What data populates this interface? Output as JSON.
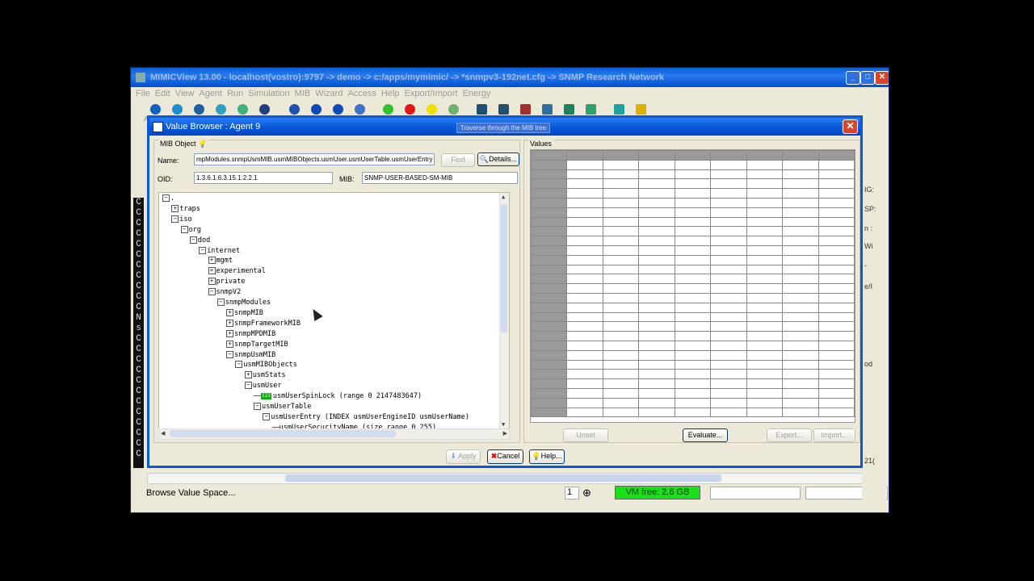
{
  "main_window": {
    "title": "MIMICView 13.00 - localhost(vostro):9797 -> demo -> c:/apps/mymimic/ -> *snmpv3-192net.cfg -> SNMP Research Network",
    "menu": [
      "File",
      "Edit",
      "View",
      "Agent",
      "Run",
      "Simulation",
      "MIB",
      "Wizard",
      "Access",
      "Help",
      "Export/Import",
      "Energy"
    ],
    "toolbar": [
      {
        "label": "Add",
        "icon": "add-icon",
        "color": "#1060c0"
      },
      {
        "label": "Configure",
        "icon": "help-icon",
        "color": "#1a8fd0"
      },
      {
        "label": "Cut",
        "icon": "cut-icon",
        "color": "#2060a0"
      },
      {
        "label": "Copy",
        "icon": "copy-icon",
        "color": "#30a0c0"
      },
      {
        "label": "Paste",
        "icon": "paste-icon",
        "color": "#40b080"
      },
      {
        "label": "Find",
        "icon": "find-icon",
        "color": "#204080"
      },
      {
        "label": "Home",
        "icon": "home-icon",
        "color": "#2050b0"
      },
      {
        "label": "Up",
        "icon": "up-icon",
        "color": "#1048b8"
      },
      {
        "label": "Prev",
        "icon": "prev-icon",
        "color": "#1048b8"
      },
      {
        "label": "Next",
        "icon": "next-icon",
        "color": "#4070c8"
      },
      {
        "label": "Start",
        "icon": "start-icon",
        "color": "#30c030"
      },
      {
        "label": "Stop",
        "icon": "stop-icon",
        "color": "#e01818"
      },
      {
        "label": "Pause",
        "icon": "pause-icon",
        "color": "#f0e000"
      },
      {
        "label": "Resume",
        "icon": "resume-icon",
        "color": "#70b070"
      },
      {
        "label": "Values",
        "icon": "values-icon",
        "color": "#205070"
      },
      {
        "label": "Action",
        "icon": "action-icon",
        "color": "#205070"
      },
      {
        "label": "Trap",
        "icon": "trap-icon",
        "color": "#a03030"
      },
      {
        "label": "Statistics",
        "icon": "statistics-icon",
        "color": "#3070a0"
      },
      {
        "label": "Script",
        "icon": "script-icon",
        "color": "#208060"
      },
      {
        "label": "Record",
        "icon": "record-icon",
        "color": "#30a070"
      },
      {
        "label": "Compile",
        "icon": "compile-icon",
        "color": "#20a0a0"
      },
      {
        "label": "Help",
        "icon": "help-bulb-icon",
        "color": "#e0b000"
      }
    ],
    "status_text": "Browse Value Space...",
    "status_number": "1",
    "vm_free": "VM free: 2.6 GB"
  },
  "left_strip_chars": [
    "C",
    "C",
    "C",
    "C",
    "C",
    "C",
    "C",
    "C",
    "C",
    "C",
    "C",
    "N",
    "s",
    "C",
    "C",
    "C",
    "C",
    "C",
    "C",
    "C",
    "C",
    "C",
    "C",
    "C",
    "C"
  ],
  "right_window_fragments": [
    "IG:",
    "SP:",
    "n :",
    "Wi",
    "-",
    "e/I",
    "od",
    "21("
  ],
  "dialog": {
    "title": "Value Browser : Agent 9",
    "tooltip": "Traverse through the MIB tree",
    "mib_object_label": "MIB Object",
    "name_label": "Name:",
    "name_value": "mpModules.snmpUsmMIB.usmMIBObjects.usmUser.usmUserTable.usmUserEntry",
    "find_label": "Find",
    "details_label": "Details...",
    "oid_label": "OID:",
    "oid_value": "1.3.6.1.6.3.15.1.2.2.1",
    "mib_label": "MIB:",
    "mib_value": "SNMP-USER-BASED-SM-MIB",
    "values_label": "Values",
    "unset_label": "Unset",
    "evaluate_label": "Evaluate...",
    "export_label": "Export...",
    "import_label": "Import...",
    "apply_label": "Apply",
    "cancel_label": "Cancel",
    "help_label": "Help...",
    "tree": [
      {
        "text": ".",
        "level": 0,
        "toggle": "minus"
      },
      {
        "text": "traps",
        "level": 1,
        "toggle": "plus"
      },
      {
        "text": "iso",
        "level": 1,
        "toggle": "minus"
      },
      {
        "text": "org",
        "level": 2,
        "toggle": "minus"
      },
      {
        "text": "dod",
        "level": 3,
        "toggle": "minus"
      },
      {
        "text": "internet",
        "level": 4,
        "toggle": "minus"
      },
      {
        "text": "mgmt",
        "level": 5,
        "toggle": "plus"
      },
      {
        "text": "experimental",
        "level": 5,
        "toggle": "plus"
      },
      {
        "text": "private",
        "level": 5,
        "toggle": "plus"
      },
      {
        "text": "snmpV2",
        "level": 5,
        "toggle": "minus"
      },
      {
        "text": "snmpModules",
        "level": 6,
        "toggle": "minus"
      },
      {
        "text": "snmpMIB",
        "level": 7,
        "toggle": "plus"
      },
      {
        "text": "snmpFrameworkMIB",
        "level": 7,
        "toggle": "plus"
      },
      {
        "text": "snmpMPDMIB",
        "level": 7,
        "toggle": "plus"
      },
      {
        "text": "snmpTargetMIB",
        "level": 7,
        "toggle": "plus"
      },
      {
        "text": "snmpUsmMIB",
        "level": 7,
        "toggle": "minus"
      },
      {
        "text": "usmMIBObjects",
        "level": 8,
        "toggle": "minus"
      },
      {
        "text": "usmStats",
        "level": 9,
        "toggle": "plus"
      },
      {
        "text": "usmUser",
        "level": 9,
        "toggle": "minus"
      },
      {
        "text": "usmUserSpinLock (range 0 2147483647)",
        "level": 10,
        "toggle": "leaf",
        "badge": "123"
      },
      {
        "text": "usmUserTable",
        "level": 10,
        "toggle": "minus"
      },
      {
        "text": "usmUserEntry (INDEX usmUserEngineID usmUserName)",
        "level": 11,
        "toggle": "minus"
      },
      {
        "text": "usmUserSecurityName (size range 0 255)",
        "level": 12,
        "toggle": "leaf"
      }
    ]
  }
}
